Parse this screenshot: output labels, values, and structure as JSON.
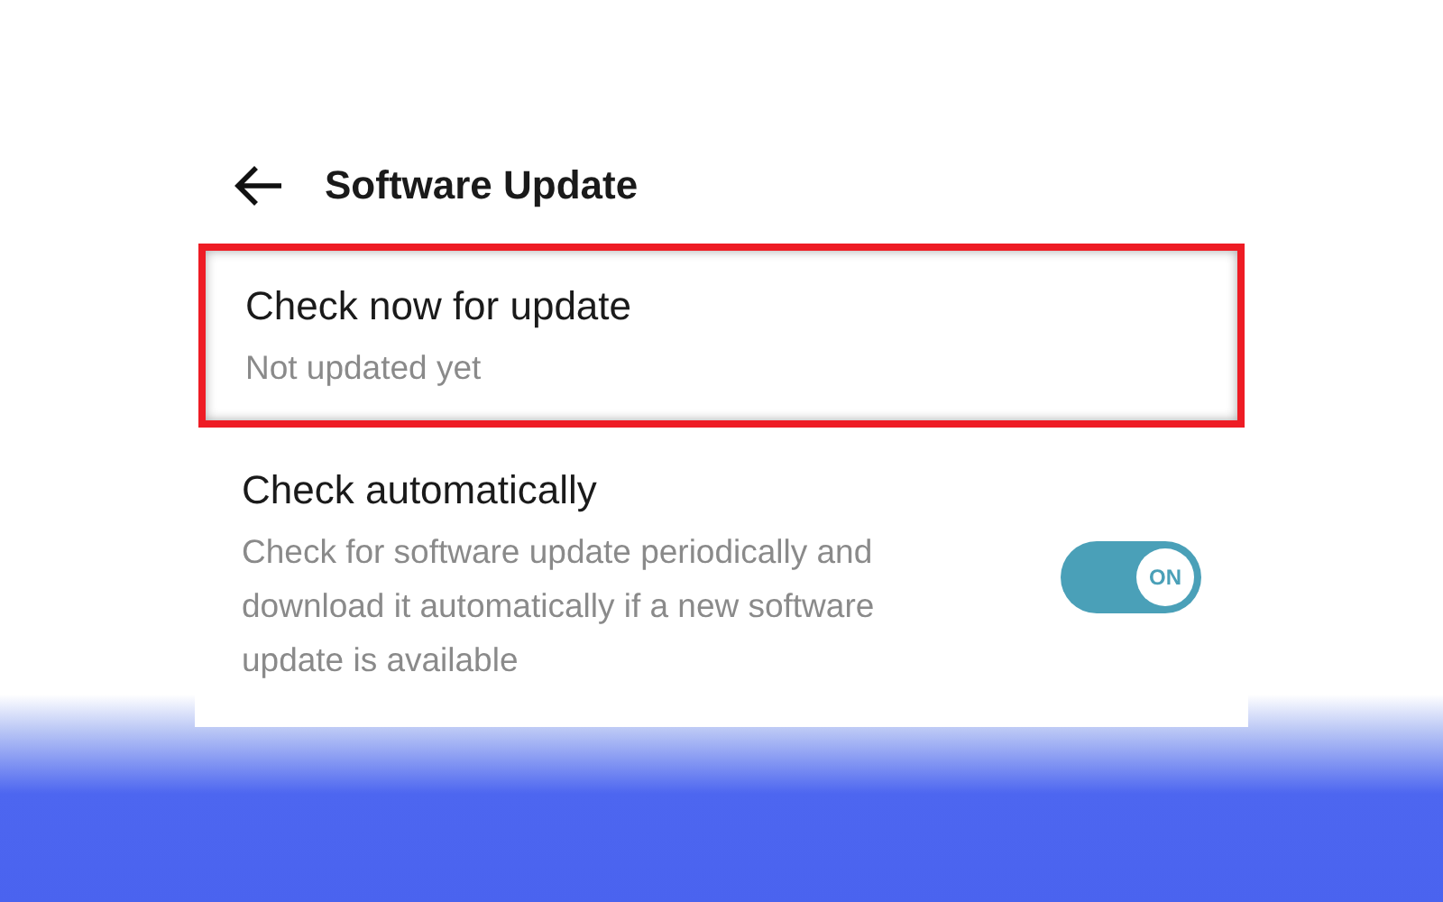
{
  "header": {
    "title": "Software Update"
  },
  "items": [
    {
      "kind": "action",
      "title": "Check now for update",
      "subtitle": "Not updated yet",
      "highlighted": true
    },
    {
      "kind": "toggle",
      "title": "Check automatically",
      "subtitle": "Check for software update periodically and download it automatically if a new software update is available",
      "on": true,
      "switch_label": "ON",
      "highlighted": false
    }
  ]
}
